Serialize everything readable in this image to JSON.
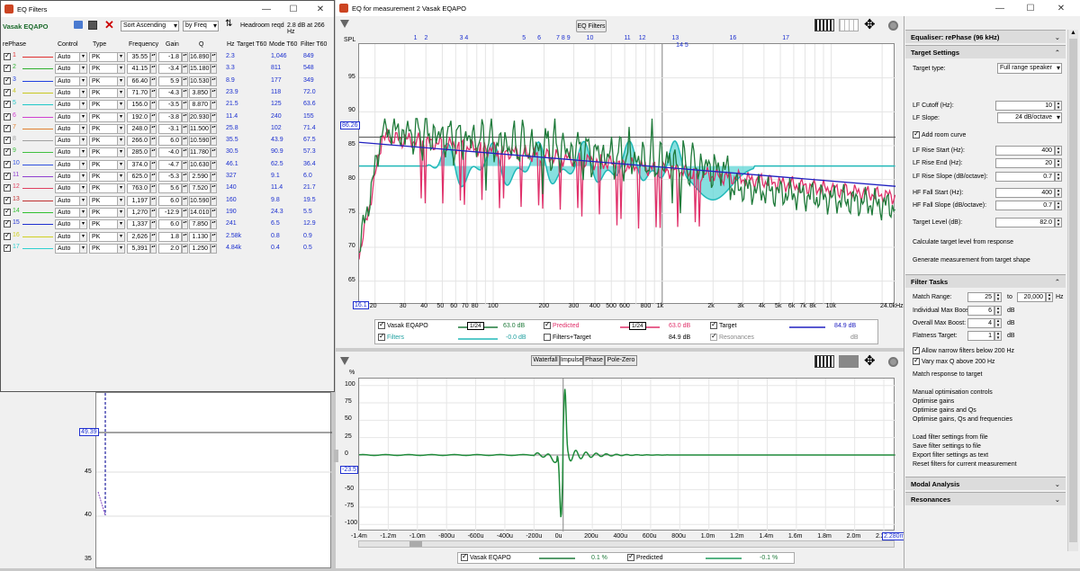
{
  "filters_window": {
    "title": "EQ Filters",
    "label": "Vasak EQAPO",
    "sort": "Sort Ascending",
    "by": "by Freq",
    "headroom_label": "Headroom reqd",
    "headroom_value": "2.8 dB at 266 Hz",
    "headers": {
      "rephase": "rePhase",
      "control": "Control",
      "type": "Type",
      "freq": "Frequency",
      "gain": "Gain",
      "q": "Q",
      "hz": "Hz",
      "target": "Target T60",
      "mode": "Mode T60",
      "filter": "Filter T60"
    },
    "rows": [
      {
        "n": "1",
        "color": "#e03030",
        "ctl": "Auto",
        "type": "PK",
        "f": "35.55",
        "g": "-1.8",
        "q": "16.890",
        "hz": "2.3",
        "t": "1,046",
        "m": "849"
      },
      {
        "n": "2",
        "color": "#30b030",
        "ctl": "Auto",
        "type": "PK",
        "f": "41.15",
        "g": "-3.4",
        "q": "15.180",
        "hz": "3.3",
        "t": "811",
        "m": "548"
      },
      {
        "n": "3",
        "color": "#2040e0",
        "ctl": "Auto",
        "type": "PK",
        "f": "66.40",
        "g": "5.9",
        "q": "10.530",
        "hz": "8.9",
        "t": "177",
        "m": "349"
      },
      {
        "n": "4",
        "color": "#c8c820",
        "ctl": "Auto",
        "type": "PK",
        "f": "71.70",
        "g": "-4.3",
        "q": "3.850",
        "hz": "23.9",
        "t": "118",
        "m": "72.0"
      },
      {
        "n": "5",
        "color": "#20c8c8",
        "ctl": "Auto",
        "type": "PK",
        "f": "156.0",
        "g": "-3.5",
        "q": "8.870",
        "hz": "21.5",
        "t": "125",
        "m": "63.6"
      },
      {
        "n": "6",
        "color": "#d040d0",
        "ctl": "Auto",
        "type": "PK",
        "f": "192.0",
        "g": "-3.8",
        "q": "20.930",
        "hz": "11.4",
        "t": "240",
        "m": "155"
      },
      {
        "n": "7",
        "color": "#e08030",
        "ctl": "Auto",
        "type": "PK",
        "f": "248.0",
        "g": "-3.1",
        "q": "11.500",
        "hz": "25.8",
        "t": "102",
        "m": "71.4"
      },
      {
        "n": "8",
        "color": "#a0a0a0",
        "ctl": "Auto",
        "type": "PK",
        "f": "266.0",
        "g": "6.0",
        "q": "10.590",
        "hz": "35.5",
        "t": "43.9",
        "m": "67.5"
      },
      {
        "n": "9",
        "color": "#40c040",
        "ctl": "Auto",
        "type": "PK",
        "f": "285.0",
        "g": "-4.0",
        "q": "11.780",
        "hz": "30.5",
        "t": "90.9",
        "m": "57.3"
      },
      {
        "n": "10",
        "color": "#3050e0",
        "ctl": "Auto",
        "type": "PK",
        "f": "374.0",
        "g": "-4.7",
        "q": "10.630",
        "hz": "46.1",
        "t": "62.5",
        "m": "36.4"
      },
      {
        "n": "11",
        "color": "#9040d0",
        "ctl": "Auto",
        "type": "PK",
        "f": "625.0",
        "g": "-5.3",
        "q": "2.590",
        "hz": "327",
        "t": "9.1",
        "m": "6.0"
      },
      {
        "n": "12",
        "color": "#e04060",
        "ctl": "Auto",
        "type": "PK",
        "f": "763.0",
        "g": "5.6",
        "q": "7.520",
        "hz": "140",
        "t": "11.4",
        "m": "21.7"
      },
      {
        "n": "13",
        "color": "#c03030",
        "ctl": "Auto",
        "type": "PK",
        "f": "1,197",
        "g": "6.0",
        "q": "10.590",
        "hz": "160",
        "t": "9.8",
        "m": "19.5"
      },
      {
        "n": "14",
        "color": "#30c030",
        "ctl": "Auto",
        "type": "PK",
        "f": "1,270",
        "g": "-12.9",
        "q": "14.010",
        "hz": "190",
        "t": "24.3",
        "m": "5.5"
      },
      {
        "n": "15",
        "color": "#2030d0",
        "ctl": "Auto",
        "type": "PK",
        "f": "1,337",
        "g": "6.0",
        "q": "7.850",
        "hz": "241",
        "t": "6.5",
        "m": "12.9"
      },
      {
        "n": "16",
        "color": "#d0d020",
        "ctl": "Auto",
        "type": "PK",
        "f": "2,626",
        "g": "1.8",
        "q": "1.130",
        "hz": "2.58k",
        "t": "0.8",
        "m": "0.9"
      },
      {
        "n": "17",
        "color": "#30d0d0",
        "ctl": "Auto",
        "type": "PK",
        "f": "5,391",
        "g": "2.0",
        "q": "1.250",
        "hz": "4.84k",
        "t": "0.4",
        "m": "0.5"
      }
    ]
  },
  "main_window": {
    "title": "EQ for measurement 2 Vasak EQAPO",
    "eq_filters_btn": "EQ Filters",
    "spl_label": "SPL",
    "pct_label": "%"
  },
  "freq_plot": {
    "yticks": [
      "95",
      "90",
      "85",
      "80",
      "75",
      "70",
      "65"
    ],
    "xticks": [
      "20",
      "30",
      "40",
      "50",
      "60",
      "70",
      "80",
      "100",
      "200",
      "300",
      "400",
      "500",
      "600",
      "800",
      "1k",
      "2k",
      "3k",
      "4k",
      "5k",
      "6k",
      "7k",
      "8k",
      "10k"
    ],
    "xstart": "16.1",
    "xend": "24.0kHz",
    "ymark": "86.26",
    "filter_markers": [
      "1",
      "2",
      "3",
      "4",
      "5",
      "6",
      "7",
      "8",
      "9",
      "10",
      "11",
      "12",
      "13",
      "14",
      "15",
      "16",
      "17"
    ],
    "marker_display": [
      "1",
      "2",
      "3 4",
      "5",
      "6",
      "7 8 9",
      "10",
      "11",
      "12",
      "13",
      "16",
      "17"
    ],
    "marker_145": "14 5"
  },
  "freq_legend": {
    "vasak": "Vasak EQAPO",
    "vasak_val": "63.0 dB",
    "smooth": "1/24",
    "predicted": "Predicted",
    "predicted_val": "63.0 dB",
    "target": "Target",
    "target_val": "84.9 dB",
    "filters": "Filters",
    "filters_val": "-0.0 dB",
    "ft": "Filters+Target",
    "ft_val": "84.9 dB",
    "res": "Resonances",
    "res_val": "dB"
  },
  "impulse_plot": {
    "tabs": [
      "Waterfall",
      "Impulse",
      "Phase",
      "Pole-Zero"
    ],
    "yticks": [
      "100",
      "75",
      "50",
      "25",
      "0",
      "-25",
      "-50",
      "-75",
      "-100"
    ],
    "ymark": "-23.5",
    "xticks": [
      "-1.4m",
      "-1.2m",
      "-1.0m",
      "-800u",
      "-600u",
      "-400u",
      "-200u",
      "0u",
      "200u",
      "400u",
      "600u",
      "800u",
      "1.0m",
      "1.2m",
      "1.4m",
      "1.6m",
      "1.8m",
      "2.0m",
      "2.2"
    ],
    "xend": "2.280m"
  },
  "impulse_legend": {
    "vasak": "Vasak EQAPO",
    "vasak_val": "0.1 %",
    "predicted": "Predicted",
    "predicted_val": "-0.1 %"
  },
  "bg_plot": {
    "ymark": "49.39",
    "yticks": [
      "45",
      "40",
      "35"
    ]
  },
  "right_panel": {
    "equaliser": "Equaliser: rePhase (96 kHz)",
    "target_settings": "Target Settings",
    "target_type_lbl": "Target type:",
    "target_type": "Full range speaker",
    "lf_cutoff_lbl": "LF Cutoff (Hz):",
    "lf_cutoff": "10",
    "lf_slope_lbl": "LF Slope:",
    "lf_slope": "24 dB/octave",
    "add_room": "Add room curve",
    "lf_rise_start_lbl": "LF Rise Start (Hz):",
    "lf_rise_start": "400",
    "lf_rise_end_lbl": "LF Rise End (Hz):",
    "lf_rise_end": "20",
    "lf_rise_slope_lbl": "LF Rise Slope (dB/octave):",
    "lf_rise_slope": "0.7",
    "hf_fall_start_lbl": "HF Fall Start (Hz):",
    "hf_fall_start": "400",
    "hf_fall_slope_lbl": "HF Fall Slope (dB/octave):",
    "hf_fall_slope": "0.7",
    "target_level_lbl": "Target Level (dB):",
    "target_level": "82.0",
    "calc_target": "Calculate target level from response",
    "gen_meas": "Generate measurement from target shape",
    "filter_tasks": "Filter Tasks",
    "match_range_lbl": "Match Range:",
    "match_lo": "25",
    "match_to": "to",
    "match_hi": "20,000",
    "hz": "Hz",
    "ind_boost_lbl": "Individual Max Boost:",
    "ind_boost": "6",
    "db": "dB",
    "overall_boost_lbl": "Overall Max Boost:",
    "overall_boost": "4",
    "flatness_lbl": "Flatness Target:",
    "flatness": "1",
    "allow_narrow": "Allow narrow filters below 200 Hz",
    "vary_q": "Vary max Q above 200 Hz",
    "match_resp": "Match response to target",
    "manual": "Manual optimisation controls",
    "opt_gains": "Optimise gains",
    "opt_gains_q": "Optimise gains and Qs",
    "opt_all": "Optimise gains, Qs and frequencies",
    "load": "Load filter settings from file",
    "save": "Save filter settings to file",
    "export": "Export filter settings as text",
    "reset": "Reset filters for current measurement",
    "modal": "Modal Analysis",
    "resonances": "Resonances"
  },
  "colors": {
    "measured": "#1f7a3a",
    "predicted": "#e0306a",
    "target": "#2020c0",
    "filters": "#20b8b8"
  }
}
